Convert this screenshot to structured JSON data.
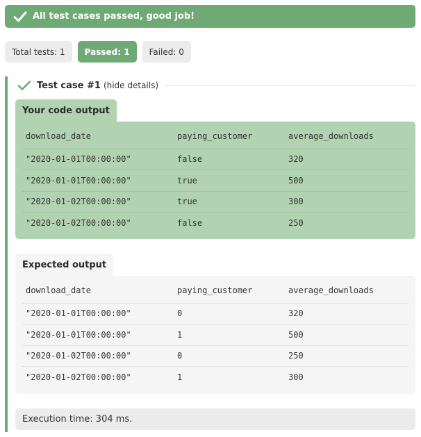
{
  "banner": {
    "message": "All test cases passed, good job!",
    "icon": "check-icon"
  },
  "summary": {
    "total": "Total tests: 1",
    "passed": "Passed: 1",
    "failed": "Failed: 0"
  },
  "test_case": {
    "title": "Test case #1",
    "toggle": "(hide details)",
    "your_output": {
      "label": "Your code output",
      "columns": [
        "download_date",
        "paying_customer",
        "average_downloads"
      ],
      "rows": [
        [
          "\"2020-01-01T00:00:00\"",
          "false",
          "320"
        ],
        [
          "\"2020-01-01T00:00:00\"",
          "true",
          "500"
        ],
        [
          "\"2020-01-02T00:00:00\"",
          "true",
          "300"
        ],
        [
          "\"2020-01-02T00:00:00\"",
          "false",
          "250"
        ]
      ]
    },
    "expected_output": {
      "label": "Expected output",
      "columns": [
        "download_date",
        "paying_customer",
        "average_downloads"
      ],
      "rows": [
        [
          "\"2020-01-01T00:00:00\"",
          "0",
          "320"
        ],
        [
          "\"2020-01-01T00:00:00\"",
          "1",
          "500"
        ],
        [
          "\"2020-01-02T00:00:00\"",
          "0",
          "250"
        ],
        [
          "\"2020-01-02T00:00:00\"",
          "1",
          "300"
        ]
      ]
    },
    "execution_time": "Execution time: 304 ms."
  },
  "colors": {
    "success": "#6fa974",
    "success_light": "#b1d3b1",
    "neutral": "#ececec"
  }
}
